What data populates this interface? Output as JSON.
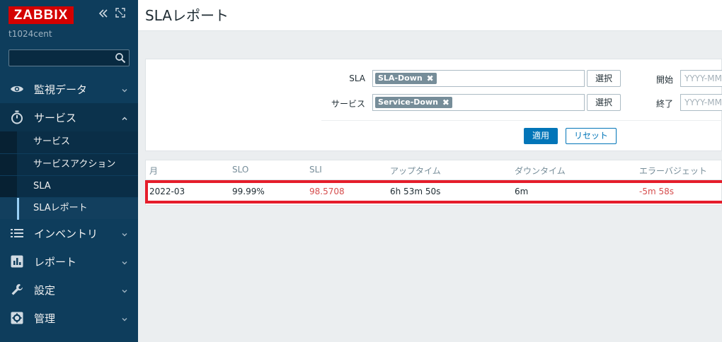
{
  "sidebar": {
    "logo": "ZABBIX",
    "host": "t1024cent",
    "search": {
      "value": "",
      "placeholder": ""
    },
    "menu": [
      {
        "label": "監視データ",
        "icon": "eye-icon"
      },
      {
        "label": "サービス",
        "icon": "stopwatch-icon"
      },
      {
        "label": "インベントリ",
        "icon": "list-icon"
      },
      {
        "label": "レポート",
        "icon": "bar-chart-icon"
      },
      {
        "label": "設定",
        "icon": "wrench-icon"
      },
      {
        "label": "管理",
        "icon": "gear-icon"
      }
    ],
    "submenu": [
      {
        "label": "サービス"
      },
      {
        "label": "サービスアクション"
      },
      {
        "label": "SLA"
      },
      {
        "label": "SLAレポート"
      }
    ]
  },
  "header": {
    "title": "SLAレポート"
  },
  "filter": {
    "sla_label": "SLA",
    "sla_tag": "SLA-Down",
    "service_label": "サービス",
    "service_tag": "Service-Down",
    "select_label": "選択",
    "from_label": "開始",
    "to_label": "終了",
    "date_placeholder": "YYYY-MM-DD",
    "apply_label": "適用",
    "reset_label": "リセット"
  },
  "table": {
    "columns": [
      "月",
      "SLO",
      "SLI",
      "アップタイム",
      "ダウンタイム",
      "エラーバジェット"
    ],
    "rows": [
      {
        "month": "2022-03",
        "slo": "99.99%",
        "sli": "98.5708",
        "uptime": "6h 53m 50s",
        "downtime": "6m",
        "error_budget": "-5m 58s"
      }
    ]
  },
  "colors": {
    "sidebar_bg": "#0e3d5c",
    "logo_red": "#d40000",
    "accent_blue": "#0275b8",
    "error_red": "#d64e4e",
    "highlight_red": "#e51d2b"
  }
}
